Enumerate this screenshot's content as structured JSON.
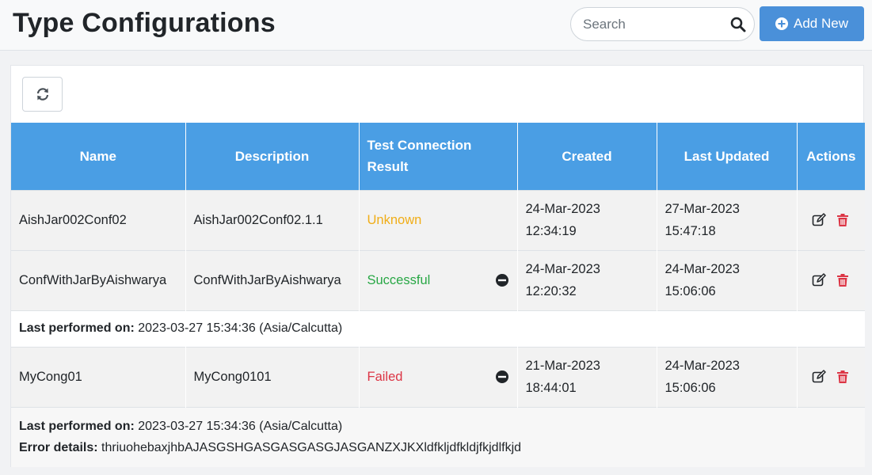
{
  "header": {
    "title": "Type Configurations",
    "search_placeholder": "Search",
    "add_label": "Add New"
  },
  "table": {
    "columns": [
      "Name",
      "Description",
      "Test Connection Result",
      "Created",
      "Last Updated",
      "Actions"
    ],
    "rows": [
      {
        "name": "AishJar002Conf02",
        "description": "AishJar002Conf02.1.1",
        "result": "Unknown",
        "created_date": "24-Mar-2023",
        "created_time": "12:34:19",
        "updated_date": "27-Mar-2023",
        "updated_time": "15:47:18"
      },
      {
        "name": "ConfWithJarByAishwarya",
        "description": "ConfWithJarByAishwarya",
        "result": "Successful",
        "created_date": "24-Mar-2023",
        "created_time": "12:20:32",
        "updated_date": "24-Mar-2023",
        "updated_time": "15:06:06",
        "detail": {
          "performed_label": "Last performed on:",
          "performed_value": " 2023-03-27 15:34:36 (Asia/Calcutta)"
        }
      },
      {
        "name": "MyCong01",
        "description": "MyCong0101",
        "result": "Failed",
        "created_date": "21-Mar-2023",
        "created_time": "18:44:01",
        "updated_date": "24-Mar-2023",
        "updated_time": "15:06:06",
        "detail": {
          "performed_label": "Last performed on:",
          "performed_value": " 2023-03-27 15:34:36 (Asia/Calcutta)",
          "error_label": "Error details:",
          "error_value": " thriuohebaxjhbAJASGSHGASGASGASGJASGANZXJKXldfkljdfkldjfkjdlfkjd"
        }
      }
    ]
  },
  "colors": {
    "primary": "#4a90d9",
    "header_bg": "#4a9ee4",
    "unknown": "#f0ad17",
    "success": "#28a745",
    "failed": "#dc3545"
  },
  "icons": [
    "search-icon",
    "plus-circle-icon",
    "refresh-icon",
    "minus-circle-icon",
    "edit-icon",
    "trash-icon"
  ]
}
